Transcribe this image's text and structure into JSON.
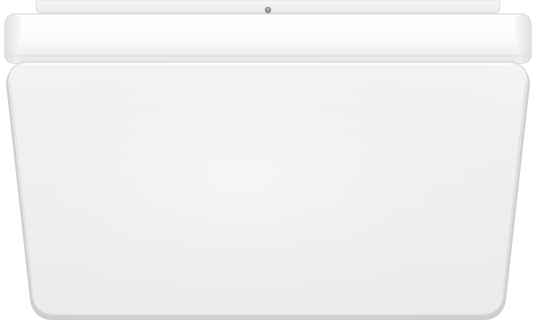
{
  "image": {
    "subject": "ceiling-light-fixture",
    "background_color": "#ffffff",
    "colors": {
      "mount_base": "#f4f4f4",
      "frame_band": "#f8f8f8",
      "diffuser_face": "#efefef",
      "edge_shadow": "#cfcfcf",
      "highlight": "#ffffff",
      "screw": "#8a8a8a"
    }
  }
}
